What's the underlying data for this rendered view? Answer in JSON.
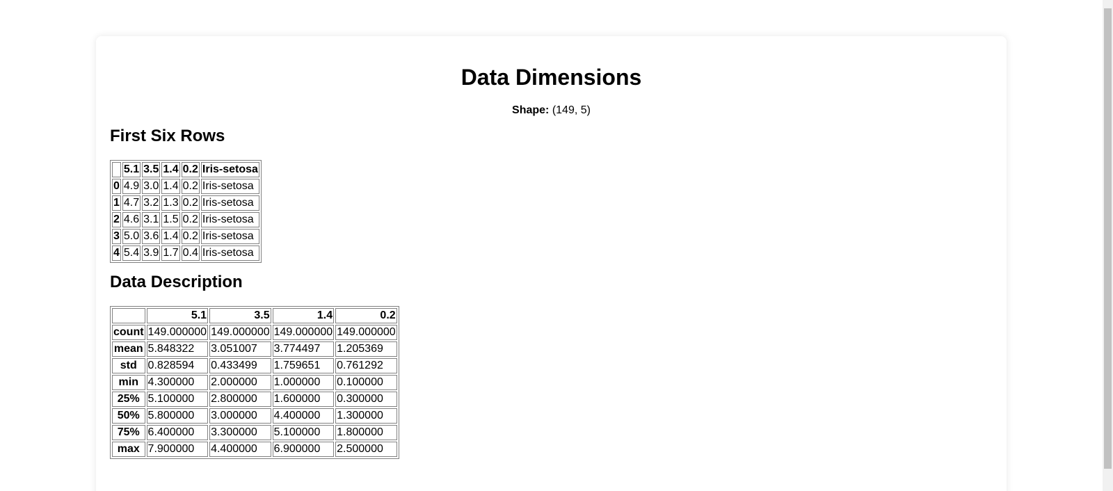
{
  "page": {
    "title": "Data Dimensions",
    "shape_label": "Shape:",
    "shape_value": "(149, 5)"
  },
  "first_rows": {
    "heading": "First Six Rows",
    "columns": [
      "",
      "5.1",
      "3.5",
      "1.4",
      "0.2",
      "Iris-setosa"
    ],
    "rows": [
      {
        "index": "0",
        "cells": [
          "4.9",
          "3.0",
          "1.4",
          "0.2",
          "Iris-setosa"
        ]
      },
      {
        "index": "1",
        "cells": [
          "4.7",
          "3.2",
          "1.3",
          "0.2",
          "Iris-setosa"
        ]
      },
      {
        "index": "2",
        "cells": [
          "4.6",
          "3.1",
          "1.5",
          "0.2",
          "Iris-setosa"
        ]
      },
      {
        "index": "3",
        "cells": [
          "5.0",
          "3.6",
          "1.4",
          "0.2",
          "Iris-setosa"
        ]
      },
      {
        "index": "4",
        "cells": [
          "5.4",
          "3.9",
          "1.7",
          "0.4",
          "Iris-setosa"
        ]
      }
    ]
  },
  "description": {
    "heading": "Data Description",
    "columns": [
      "",
      "5.1",
      "3.5",
      "1.4",
      "0.2"
    ],
    "rows": [
      {
        "index": "count",
        "cells": [
          "149.000000",
          "149.000000",
          "149.000000",
          "149.000000"
        ]
      },
      {
        "index": "mean",
        "cells": [
          "5.848322",
          "3.051007",
          "3.774497",
          "1.205369"
        ]
      },
      {
        "index": "std",
        "cells": [
          "0.828594",
          "0.433499",
          "1.759651",
          "0.761292"
        ]
      },
      {
        "index": "min",
        "cells": [
          "4.300000",
          "2.000000",
          "1.000000",
          "0.100000"
        ]
      },
      {
        "index": "25%",
        "cells": [
          "5.100000",
          "2.800000",
          "1.600000",
          "0.300000"
        ]
      },
      {
        "index": "50%",
        "cells": [
          "5.800000",
          "3.000000",
          "4.400000",
          "1.300000"
        ]
      },
      {
        "index": "75%",
        "cells": [
          "6.400000",
          "3.300000",
          "5.100000",
          "1.800000"
        ]
      },
      {
        "index": "max",
        "cells": [
          "7.900000",
          "4.400000",
          "6.900000",
          "2.500000"
        ]
      }
    ]
  }
}
